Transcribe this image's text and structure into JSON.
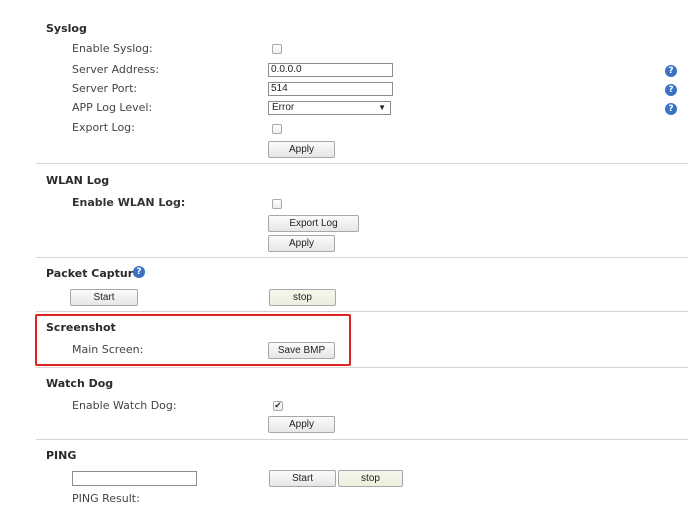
{
  "syslog": {
    "title": "Syslog",
    "enable_label": "Enable Syslog:",
    "enable_checked": false,
    "server_address_label": "Server Address:",
    "server_address_value": "0.0.0.0",
    "server_port_label": "Server Port:",
    "server_port_value": "514",
    "app_log_level_label": "APP Log Level:",
    "app_log_level_value": "Error",
    "export_log_label": "Export Log:",
    "export_log_checked": false,
    "apply_label": "Apply"
  },
  "wlan_log": {
    "title": "WLAN Log",
    "enable_label": "Enable WLAN Log:",
    "enable_checked": false,
    "export_log_button": "Export Log",
    "apply_label": "Apply"
  },
  "packet_capture": {
    "title": "Packet Capture",
    "start_label": "Start",
    "stop_label": "stop"
  },
  "screenshot": {
    "title": "Screenshot",
    "main_screen_label": "Main Screen:",
    "save_bmp_label": "Save BMP",
    "highlight_color": "#e02424"
  },
  "watch_dog": {
    "title": "Watch Dog",
    "enable_label": "Enable Watch Dog:",
    "enable_checked": true,
    "apply_label": "Apply"
  },
  "ping": {
    "title": "PING",
    "host_value": "",
    "start_label": "Start",
    "stop_label": "stop",
    "result_label": "PING Result:"
  },
  "icons": {
    "help": "question-mark-icon",
    "checkmark": "checkmark-icon",
    "dropdown": "chevron-down-icon"
  },
  "colors": {
    "help_icon": "#3a73c4",
    "divider": "#d4d4d4"
  }
}
